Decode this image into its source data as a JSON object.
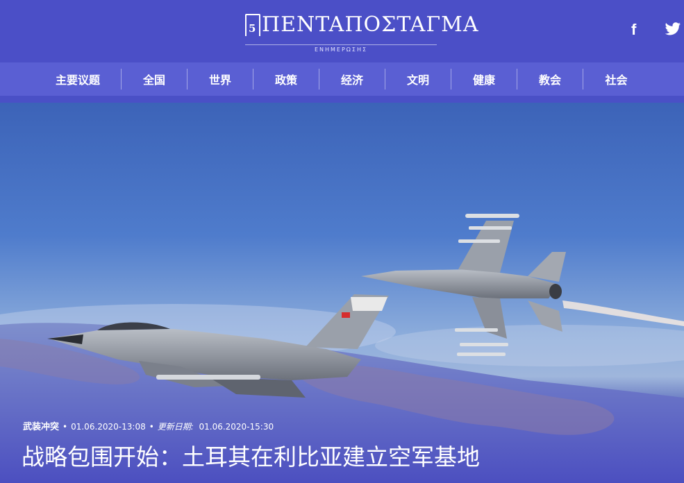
{
  "site": {
    "logo_mark": "5",
    "logo_title": "ΠENTAΠOΣTAΓMA",
    "logo_subtitle": "ΕΝΗΜΕΡΩΣΗΣ"
  },
  "social": {
    "facebook_icon": "facebook-icon",
    "twitter_icon": "twitter-icon",
    "facebook_glyph": "f"
  },
  "nav": {
    "items": [
      "主要议题",
      "全国",
      "世界",
      "政策",
      "经济",
      "文明",
      "健康",
      "教会",
      "社会"
    ]
  },
  "article": {
    "category": "武装冲突",
    "published": "01.06.2020-13:08",
    "updated_label": "更新日期:",
    "updated": "01.06.2020-15:30",
    "title": "战略包围开始：土耳其在利比亚建立空军基地"
  },
  "colors": {
    "header_bg": "#4b4fc7",
    "nav_bg": "#5a5fd3",
    "text": "#ffffff"
  }
}
